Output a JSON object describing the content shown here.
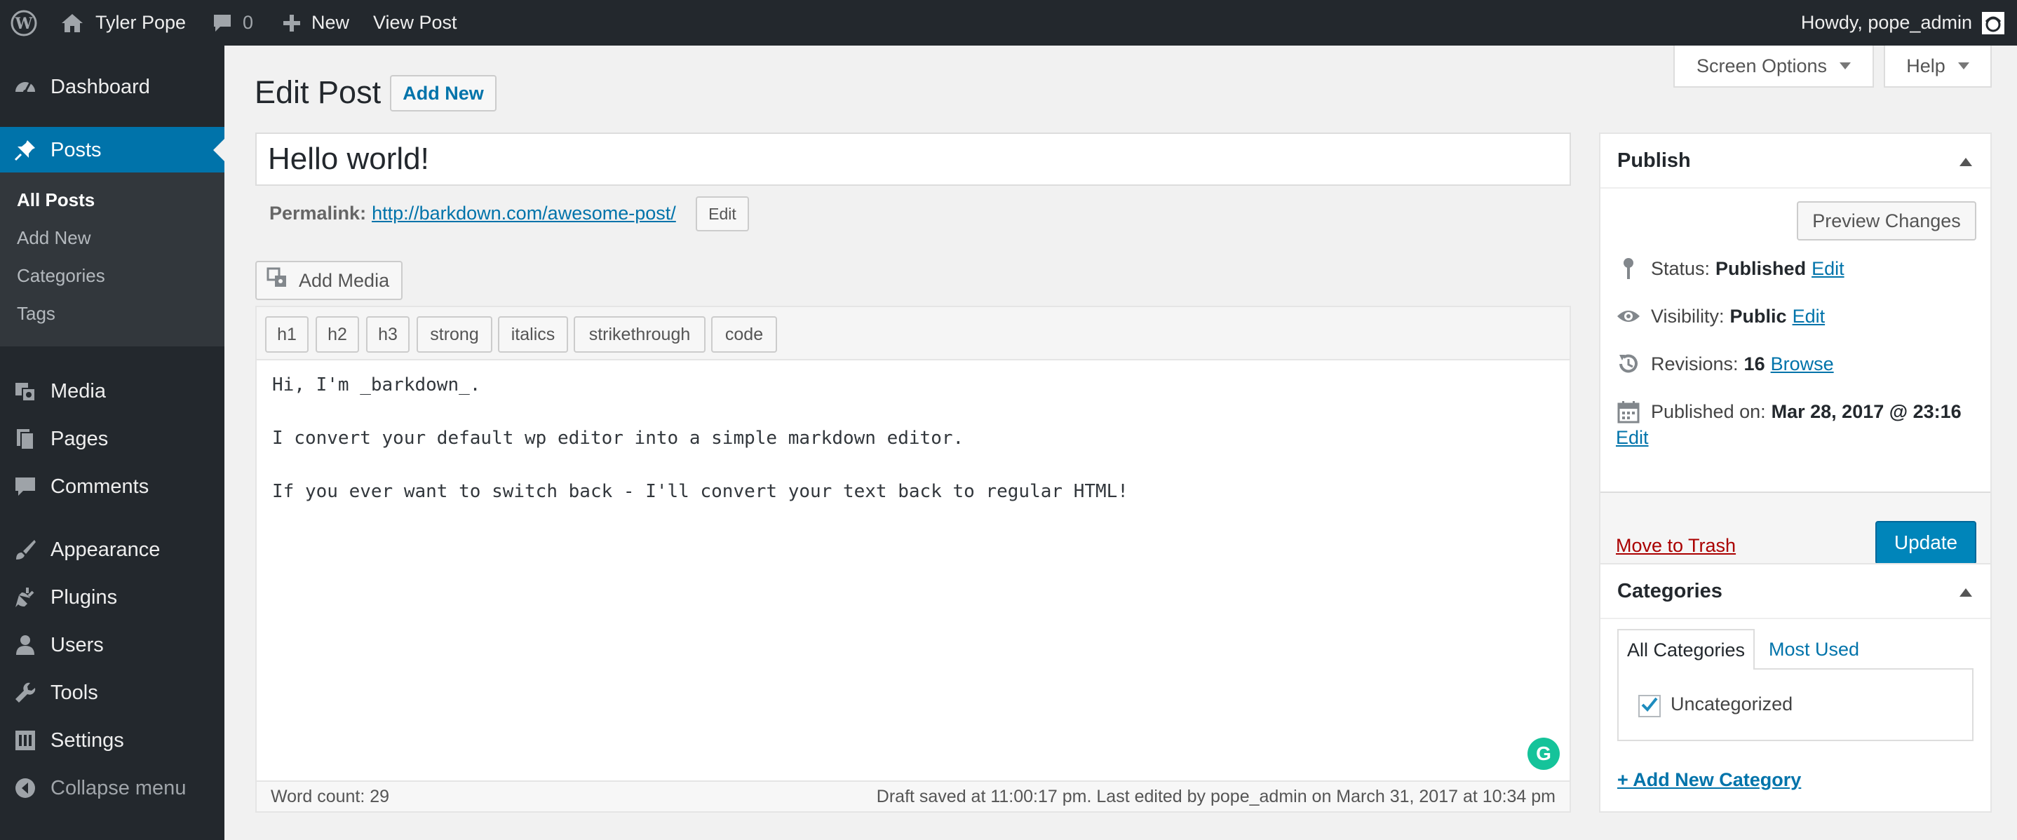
{
  "admin_bar": {
    "site_name": "Tyler Pope",
    "comments_count": "0",
    "new_label": "New",
    "view_post_label": "View Post",
    "greeting": "Howdy, pope_admin"
  },
  "sidebar": {
    "items": [
      {
        "label": "Dashboard",
        "icon": "dashboard-icon"
      },
      {
        "label": "Posts",
        "icon": "pin-icon"
      },
      {
        "label": "Media",
        "icon": "media-icon"
      },
      {
        "label": "Pages",
        "icon": "pages-icon"
      },
      {
        "label": "Comments",
        "icon": "comment-icon"
      },
      {
        "label": "Appearance",
        "icon": "brush-icon"
      },
      {
        "label": "Plugins",
        "icon": "plug-icon"
      },
      {
        "label": "Users",
        "icon": "user-icon"
      },
      {
        "label": "Tools",
        "icon": "wrench-icon"
      },
      {
        "label": "Settings",
        "icon": "settings-icon"
      }
    ],
    "submenu": [
      "All Posts",
      "Add New",
      "Categories",
      "Tags"
    ],
    "collapse_label": "Collapse menu"
  },
  "screen_options_label": "Screen Options",
  "help_label": "Help",
  "page": {
    "title": "Edit Post",
    "add_new_label": "Add New"
  },
  "post": {
    "title": "Hello world!",
    "permalink_label": "Permalink:",
    "permalink_url": "http://barkdown.com/awesome-post/",
    "permalink_edit": "Edit",
    "add_media_label": "Add Media"
  },
  "editor": {
    "toolbar": [
      "h1",
      "h2",
      "h3",
      "strong",
      "italics",
      "strikethrough",
      "code"
    ],
    "lines": [
      "Hi, I'm _barkdown_.",
      "",
      "I convert your default wp editor into a simple markdown editor.",
      "",
      "If you ever want to switch back - I'll convert your text back to regular HTML!"
    ],
    "word_count": "Word count: 29",
    "draft_status": "Draft saved at 11:00:17 pm. Last edited by pope_admin on March 31, 2017 at 10:34 pm",
    "grammarly_letter": "G"
  },
  "publish": {
    "title": "Publish",
    "preview_label": "Preview Changes",
    "status_label": "Status:",
    "status_value": "Published",
    "visibility_label": "Visibility:",
    "visibility_value": "Public",
    "revisions_label": "Revisions:",
    "revisions_value": "16",
    "browse_label": "Browse",
    "published_on_label": "Published on:",
    "published_on_value": "Mar 28, 2017 @ 23:16",
    "edit_label": "Edit",
    "trash_label": "Move to Trash",
    "update_label": "Update"
  },
  "categories": {
    "title": "Categories",
    "tab_all": "All Categories",
    "tab_most_used": "Most Used",
    "items": [
      {
        "label": "Uncategorized",
        "checked": true
      }
    ],
    "add_new_label": "+ Add New Category"
  },
  "colors": {
    "admin_dark": "#23282d",
    "accent": "#0073aa",
    "primary_button": "#0085ba",
    "trash": "#a00000",
    "grammarly": "#15c39a"
  }
}
